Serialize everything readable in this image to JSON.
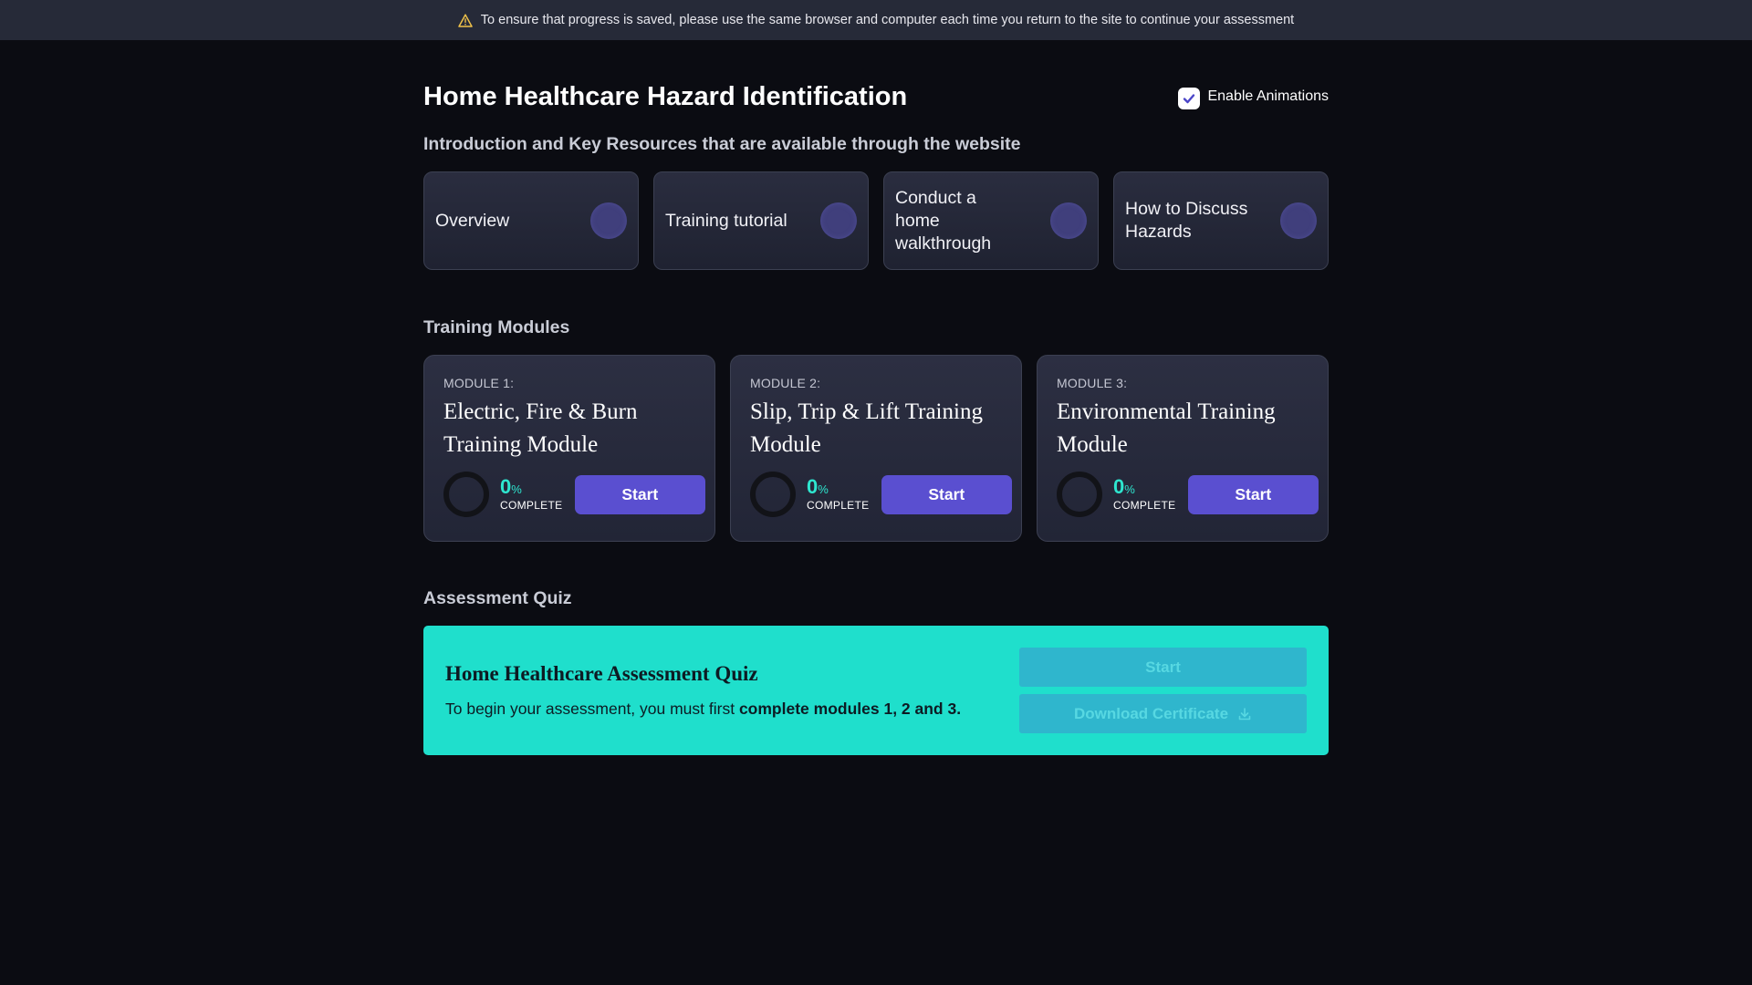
{
  "banner": {
    "icon": "warning-icon",
    "text": "To ensure that progress is saved, please use the same browser and computer each time you return to the site to continue your assessment"
  },
  "header": {
    "title": "Home Healthcare Hazard Identification",
    "animations": {
      "label": "Enable Animations",
      "checked": true
    }
  },
  "intro": {
    "heading": "Introduction and Key Resources that are available through the website",
    "resources": [
      {
        "label": "Overview"
      },
      {
        "label": "Training tutorial"
      },
      {
        "label": "Conduct a home walkthrough"
      },
      {
        "label": "How to Discuss Hazards"
      }
    ]
  },
  "modules": {
    "heading": "Training Modules",
    "items": [
      {
        "number": "MODULE 1:",
        "title": "Electric, Fire & Burn Training Module",
        "percent": "0",
        "percent_sign": "%",
        "complete_label": "COMPLETE",
        "button": "Start"
      },
      {
        "number": "MODULE 2:",
        "title": "Slip, Trip & Lift Training Module",
        "percent": "0",
        "percent_sign": "%",
        "complete_label": "COMPLETE",
        "button": "Start"
      },
      {
        "number": "MODULE 3:",
        "title": "Environmental Training Module",
        "percent": "0",
        "percent_sign": "%",
        "complete_label": "COMPLETE",
        "button": "Start"
      }
    ]
  },
  "quiz": {
    "heading": "Assessment Quiz",
    "title": "Home Healthcare Assessment Quiz",
    "desc_prefix": "To begin your assessment, you must first ",
    "desc_bold": "complete modules 1, 2 and 3.",
    "start_button": "Start",
    "download_button": "Download Certificate",
    "download_icon": "download-icon"
  },
  "colors": {
    "background": "#0b0c12",
    "banner": "#262a38",
    "accent_purple": "#5a4fd0",
    "accent_teal": "#1fdfcc",
    "percent_teal": "#2ee6cf"
  }
}
